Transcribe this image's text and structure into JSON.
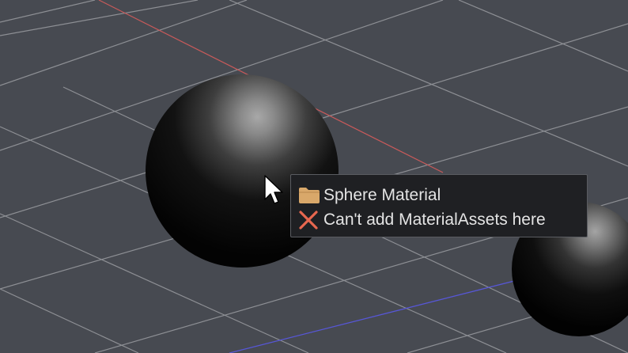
{
  "viewport": {
    "background_color": "#474a51",
    "grid_color": "#8d8f94",
    "x_axis_color": "#c95a5a",
    "z_axis_color": "#5757d6"
  },
  "drag_tooltip": {
    "asset_icon": "folder-icon",
    "asset_name": "Sphere Material",
    "status_icon": "close-icon",
    "status_icon_color": "#e8674f",
    "status_message": "Can't add MaterialAssets here"
  },
  "cursor": {
    "icon": "arrow-cursor-icon"
  }
}
